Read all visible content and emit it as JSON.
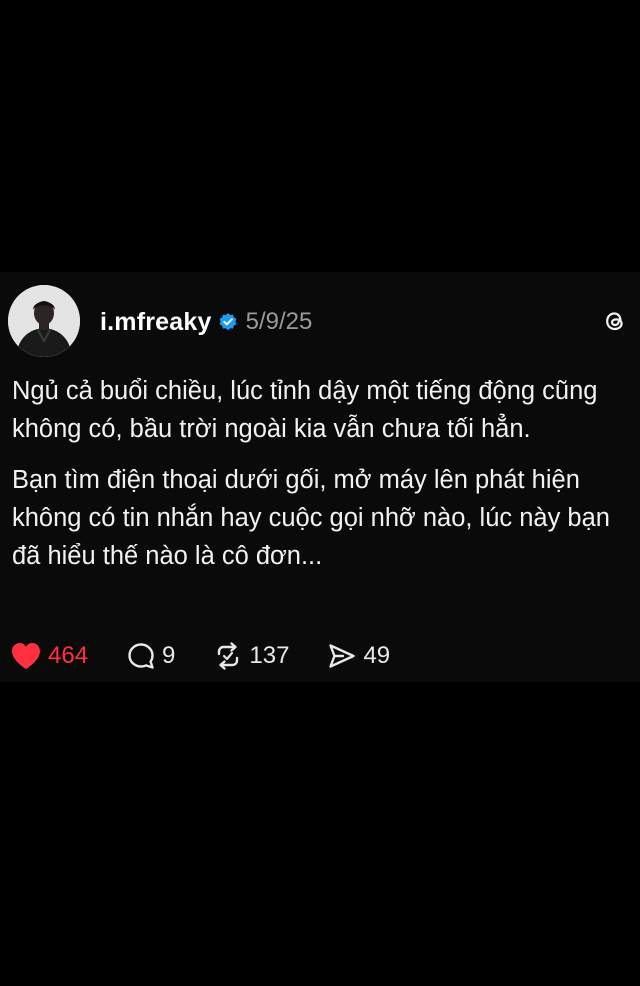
{
  "post": {
    "author": {
      "username": "i.mfreaky",
      "verified_icon": "verified-badge-icon",
      "avatar": "avatar-photo"
    },
    "date": "5/9/25",
    "platform_icon": "threads-logo-icon",
    "paragraphs": [
      "Ngủ cả buổi chiều, lúc tỉnh dậy một tiếng động cũng không có, bầu trời ngoài kia vẫn chưa tối hẳn.",
      "Bạn tìm điện thoại dưới gối, mở máy lên phát hiện không có tin nhắn hay cuộc gọi nhỡ nào, lúc này bạn đã hiểu thế nào là cô đơn..."
    ],
    "actions": {
      "likes": "464",
      "replies": "9",
      "reposts": "137",
      "shares": "49"
    }
  },
  "colors": {
    "background": "#000000",
    "card": "#0a0a0a",
    "like_red": "#ff3040",
    "verified_blue": "#1d9bf0",
    "muted_text": "#9a9a9a"
  }
}
